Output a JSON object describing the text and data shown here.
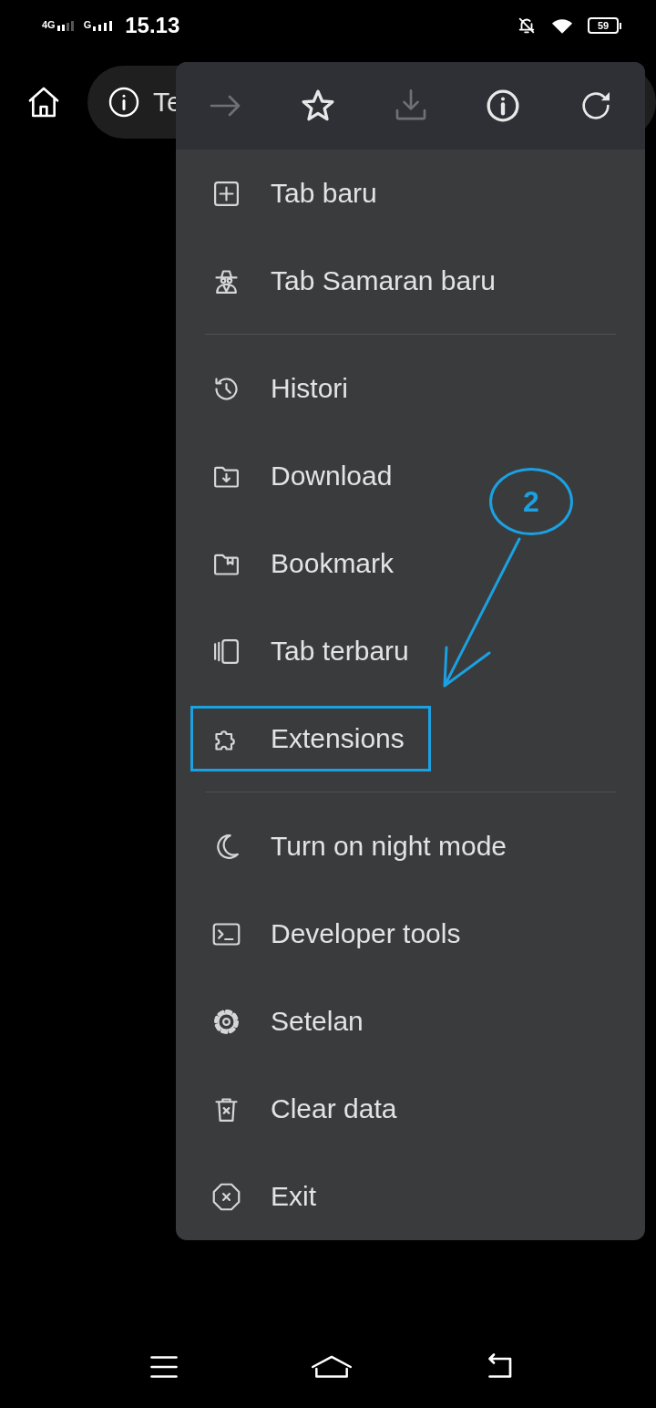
{
  "status_bar": {
    "network_1": "4G",
    "network_2": "G",
    "time": "15.13",
    "battery": "59"
  },
  "address_bar": {
    "text": "Te"
  },
  "menu": {
    "toolbar": [
      {
        "kind": "forward",
        "disabled": true
      },
      {
        "kind": "bookmark",
        "disabled": false
      },
      {
        "kind": "download",
        "disabled": true
      },
      {
        "kind": "info",
        "disabled": false
      },
      {
        "kind": "reload",
        "disabled": false
      }
    ],
    "sections": [
      {
        "items": [
          {
            "kind": "new-tab",
            "label": "Tab baru",
            "highlighted": false
          },
          {
            "kind": "incognito",
            "label": "Tab Samaran baru",
            "highlighted": false
          }
        ]
      },
      {
        "items": [
          {
            "kind": "history",
            "label": "Histori",
            "highlighted": false
          },
          {
            "kind": "downloads",
            "label": "Download",
            "highlighted": false
          },
          {
            "kind": "bookmarks",
            "label": "Bookmark",
            "highlighted": false
          },
          {
            "kind": "recent-tabs",
            "label": "Tab terbaru",
            "highlighted": false
          },
          {
            "kind": "extensions",
            "label": "Extensions",
            "highlighted": true
          }
        ]
      },
      {
        "items": [
          {
            "kind": "night",
            "label": "Turn on night mode",
            "highlighted": false
          },
          {
            "kind": "devtools",
            "label": "Developer tools",
            "highlighted": false
          },
          {
            "kind": "settings",
            "label": "Setelan",
            "highlighted": false
          },
          {
            "kind": "clear",
            "label": "Clear data",
            "highlighted": false
          },
          {
            "kind": "exit",
            "label": "Exit",
            "highlighted": false
          }
        ]
      }
    ]
  },
  "annotation": {
    "step": "2"
  }
}
